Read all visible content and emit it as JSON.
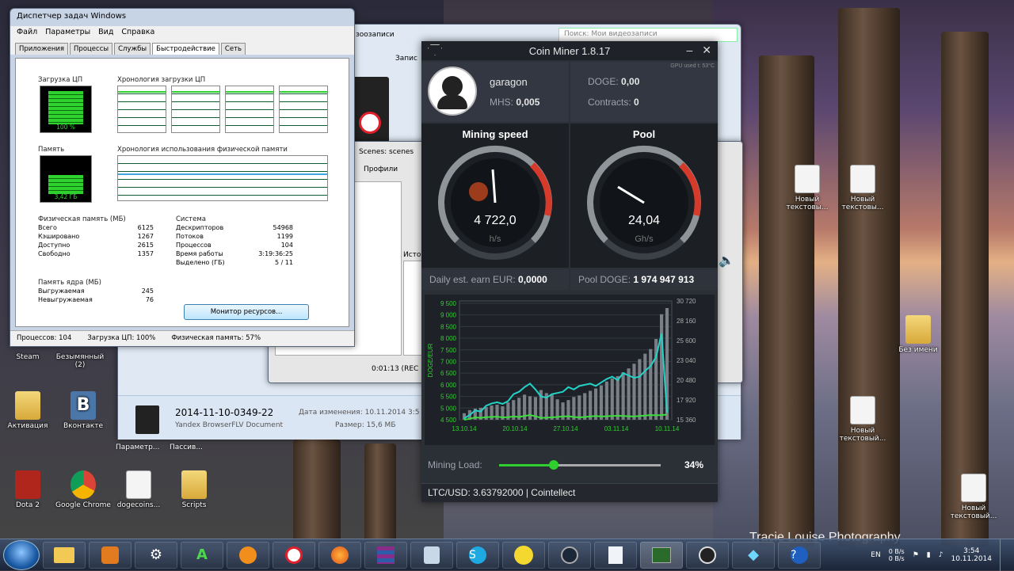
{
  "taskmgr": {
    "title": "Диспетчер задач Windows",
    "menu": [
      "Файл",
      "Параметры",
      "Вид",
      "Справка"
    ],
    "tabs": [
      "Приложения",
      "Процессы",
      "Службы",
      "Быстродействие",
      "Сеть"
    ],
    "cpu_label": "Загрузка ЦП",
    "cpu_value": "100 %",
    "cpu_history_label": "Хронология загрузки ЦП",
    "mem_label": "Память",
    "mem_value": "3,42 ГБ",
    "mem_history_label": "Хронология использования физической памяти",
    "phys_mem_header": "Физическая память (МБ)",
    "phys_mem": [
      {
        "k": "Всего",
        "v": "6125"
      },
      {
        "k": "Кэшировано",
        "v": "1267"
      },
      {
        "k": "Доступно",
        "v": "2615"
      },
      {
        "k": "Свободно",
        "v": "1357"
      }
    ],
    "kernel_header": "Память ядра (МБ)",
    "kernel_mem": [
      {
        "k": "Выгружаемая",
        "v": "245"
      },
      {
        "k": "Невыгружаемая",
        "v": "76"
      }
    ],
    "system_header": "Система",
    "system": [
      {
        "k": "Дескрипторов",
        "v": "54968"
      },
      {
        "k": "Потоков",
        "v": "1199"
      },
      {
        "k": "Процессов",
        "v": "104"
      },
      {
        "k": "Время работы",
        "v": "3:19:36:25"
      },
      {
        "k": "Выделено (ГБ)",
        "v": "5 / 11"
      }
    ],
    "resource_button": "Монитор ресурсов...",
    "status": [
      "Процессов: 104",
      "Загрузка ЦП: 100%",
      "Физическая память: 57%"
    ]
  },
  "explorer": {
    "search_placeholder": "Поиск: Мои видеозаписи",
    "file_name": "2014-11-10-0349-22",
    "file_type": "Yandex BrowserFLV Document",
    "date_label": "Дата изменения: 10.11.2014 3:5",
    "size_label": "Размер: 15,6 МБ",
    "tab_fragment": "Запис",
    "fragment_records": "зоозаписи"
  },
  "obs": {
    "scenes_fragment": "Scenes: scenes",
    "profiles": "Профили",
    "sources_fragment": "Исто",
    "timer": "0:01:13 (REC"
  },
  "miner": {
    "title": "Coin Miner 1.8.17",
    "gpu_note": "GPU used t: 53°C",
    "username": "garagon",
    "mhs_label": "MHS:",
    "mhs_value": "0,005",
    "doge_label": "DOGE:",
    "doge_value": "0,00",
    "contracts_label": "Contracts:",
    "contracts_value": "0",
    "speed_title": "Mining speed",
    "speed_value": "4 722,0",
    "speed_unit": "h/s",
    "pool_title": "Pool",
    "pool_value": "24,04",
    "pool_unit": "Gh/s",
    "earn_label": "Daily est. earn EUR:",
    "earn_value": "0,0000",
    "pool_doge_label": "Pool DOGE:",
    "pool_doge_value": "1 974 947 913",
    "load_label": "Mining Load:",
    "load_value": "34%",
    "load_fraction": 0.34,
    "ticker": "LTC/USD: 3.63792000 | Cointellect",
    "accent": "#22d3c5",
    "needle_red": "#d63a2a"
  },
  "chart_data": {
    "type": "bar",
    "ylabel": "DOGE/EUR",
    "x_ticks": [
      "13.10.14",
      "20.10.14",
      "27.10.14",
      "03.11.14",
      "10.11.14"
    ],
    "y_left_ticks": [
      "4 500",
      "5 000",
      "5 500",
      "6 000",
      "6 500",
      "7 000",
      "7 500",
      "8 000",
      "8 500",
      "9 000",
      "9 500"
    ],
    "y_right_ticks": [
      "15 360",
      "17 920",
      "20 480",
      "23 040",
      "25 600",
      "28 160",
      "30 720"
    ],
    "y_left_range": [
      4500,
      9600
    ],
    "y_right_range": [
      15360,
      30720
    ],
    "series": [
      {
        "type": "bar",
        "color": "#7a7f87",
        "values": [
          16200,
          16600,
          16800,
          16900,
          17000,
          17200,
          17300,
          17100,
          17600,
          17900,
          18200,
          18600,
          18400,
          18300,
          19200,
          18800,
          18600,
          18000,
          17600,
          17900,
          18300,
          18500,
          18800,
          19100,
          19400,
          19800,
          20300,
          20700,
          21000,
          21500,
          22000,
          22600,
          23200,
          23900,
          24500,
          25800,
          29000,
          29800
        ]
      },
      {
        "type": "line",
        "color": "#22d3c5",
        "values": [
          4560,
          4700,
          4900,
          4850,
          5100,
          5200,
          5250,
          5180,
          5300,
          5600,
          5700,
          5900,
          6050,
          5800,
          5500,
          5450,
          5600,
          5650,
          5700,
          5900,
          5800,
          5950,
          6000,
          6050,
          5950,
          6100,
          6250,
          6350,
          6200,
          6500,
          6400,
          6300,
          6350,
          6600,
          6800,
          7200,
          8200,
          4800
        ]
      },
      {
        "type": "line",
        "color": "#3ddc3d",
        "values": [
          4500,
          4540,
          4600,
          4580,
          4610,
          4620,
          4630,
          4600,
          4610,
          4640,
          4620,
          4660,
          4700,
          4650,
          4580,
          4590,
          4600,
          4620,
          4640,
          4650,
          4620,
          4600,
          4620,
          4640,
          4660,
          4640,
          4650,
          4660,
          4670,
          4660,
          4650,
          4640,
          4660,
          4680,
          4700,
          4690,
          4700,
          4720
        ]
      }
    ]
  },
  "desktop": {
    "icons": [
      {
        "label": "Steam"
      },
      {
        "label": "Безымянный (2)"
      },
      {
        "label": "Активация"
      },
      {
        "label": "Вконтакте"
      },
      {
        "label": "Dota 2"
      },
      {
        "label": "Google Chrome"
      },
      {
        "label": "dogecoins..."
      },
      {
        "label": "Scripts"
      },
      {
        "label": "Новый текстовы..."
      },
      {
        "label": "Новый текстовы..."
      },
      {
        "label": "Новый текстовый..."
      },
      {
        "label": "Новый текстовый..."
      },
      {
        "label": "Без имени"
      }
    ],
    "fragments": [
      "Параметр...",
      "Пассив..."
    ],
    "watermark": "Tracie Louise Photography"
  },
  "taskbar": {
    "lang": "EN",
    "net_up": "0 B/s",
    "net_down": "0 B/s",
    "time": "3:54",
    "date": "10.11.2014"
  }
}
